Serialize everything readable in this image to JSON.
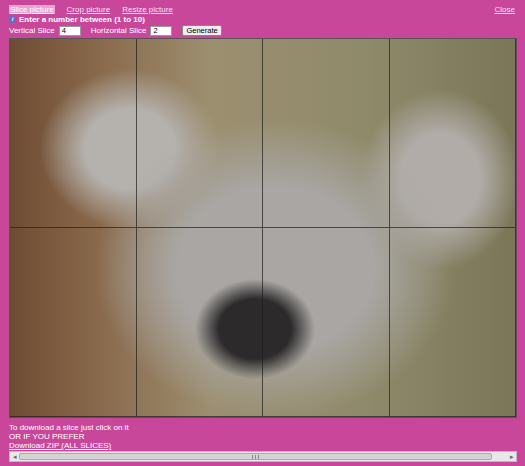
{
  "window": {
    "close": "Close"
  },
  "tabs": [
    {
      "label": "Slice picture",
      "selected": true
    },
    {
      "label": "Crop picture",
      "selected": false
    },
    {
      "label": "Resize picture",
      "selected": false
    }
  ],
  "instruction": {
    "icon": "i",
    "text": "Enter a number between (1 to 10)"
  },
  "fields": [
    {
      "label": "Vertical Slice",
      "value": "4"
    },
    {
      "label": "Horizontal Slice",
      "value": "2"
    }
  ],
  "button": "Generate",
  "footer": {
    "hint": "To download a slice just click on it",
    "or": "OR IF YOU PREFER",
    "link": "Download ZIP (ALL SLICES)"
  },
  "scrollbar": {
    "left": "◂",
    "right": "▸",
    "level": 0.97
  }
}
